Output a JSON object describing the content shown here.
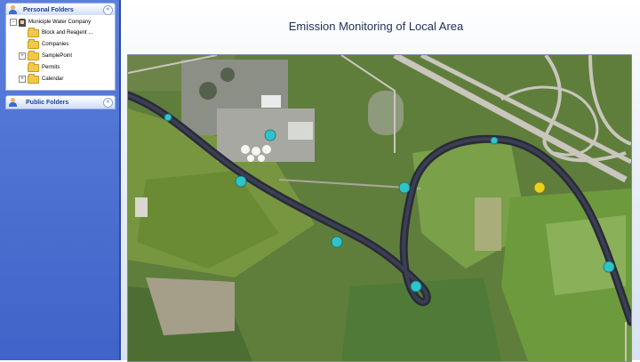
{
  "sidebar": {
    "personal_folders": {
      "title": "Personal Folders",
      "collapse_glyph": "«",
      "tree": [
        {
          "label": "Municiple Water Company",
          "expander": "−",
          "icon": "company-icon"
        },
        {
          "label": "Block and Reagent ...",
          "expander": "",
          "icon": "folder-icon"
        },
        {
          "label": "Companies",
          "expander": "",
          "icon": "folder-icon"
        },
        {
          "label": "SamplePoint",
          "expander": "+",
          "icon": "folder-icon"
        },
        {
          "label": "Permits",
          "expander": "",
          "icon": "folder-icon"
        },
        {
          "label": "Calendar",
          "expander": "+",
          "icon": "folder-icon"
        }
      ]
    },
    "public_folders": {
      "title": "Public Folders",
      "collapse_glyph": "«"
    }
  },
  "main": {
    "title": "Emission Monitoring of Local Area",
    "sensors": [
      {
        "id": "s1",
        "status": "normal"
      },
      {
        "id": "s2",
        "status": "normal"
      },
      {
        "id": "s3",
        "status": "normal"
      },
      {
        "id": "s4",
        "status": "normal"
      },
      {
        "id": "s5",
        "status": "normal"
      },
      {
        "id": "s6",
        "status": "normal"
      },
      {
        "id": "s7",
        "status": "normal"
      },
      {
        "id": "s8",
        "status": "warning"
      },
      {
        "id": "s9",
        "status": "normal"
      }
    ],
    "status_colors": {
      "normal": "#2fc4c8",
      "warning": "#e8d21d"
    }
  }
}
